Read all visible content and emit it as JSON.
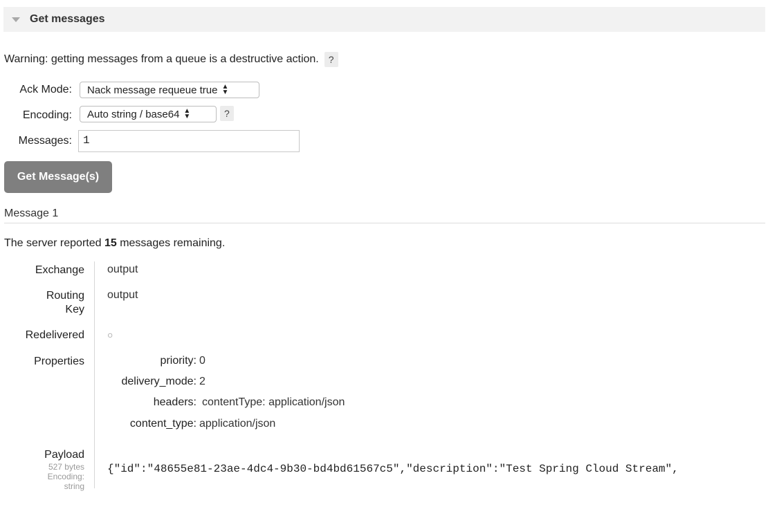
{
  "section": {
    "title": "Get messages"
  },
  "warning": {
    "text": "Warning: getting messages from a queue is a destructive action.",
    "help": "?"
  },
  "form": {
    "ack_mode_label": "Ack Mode:",
    "ack_mode_value": "Nack message requeue true",
    "encoding_label": "Encoding:",
    "encoding_value": "Auto string / base64",
    "encoding_help": "?",
    "messages_label": "Messages:",
    "messages_value": "1",
    "submit_label": "Get Message(s)"
  },
  "message": {
    "heading": "Message 1",
    "remaining_prefix": "The server reported ",
    "remaining_count": "15",
    "remaining_suffix": " messages remaining.",
    "fields": {
      "exchange_label": "Exchange",
      "exchange_value": "output",
      "routing_key_label_1": "Routing",
      "routing_key_label_2": "Key",
      "routing_key_value": "output",
      "redelivered_label": "Redelivered",
      "redelivered_value": "○",
      "properties_label": "Properties"
    },
    "properties": {
      "priority_label": "priority:",
      "priority_value": "0",
      "delivery_mode_label": "delivery_mode:",
      "delivery_mode_value": "2",
      "headers_label": "headers:",
      "headers_key": "contentType:",
      "headers_value": "application/json",
      "content_type_label": "content_type:",
      "content_type_value": "application/json"
    },
    "payload": {
      "label": "Payload",
      "size": "527 bytes",
      "encoding_label": "Encoding:",
      "encoding_value": "string",
      "text": "{\"id\":\"48655e81-23ae-4dc4-9b30-bd4bd61567c5\",\"description\":\"Test Spring Cloud Stream\","
    }
  }
}
